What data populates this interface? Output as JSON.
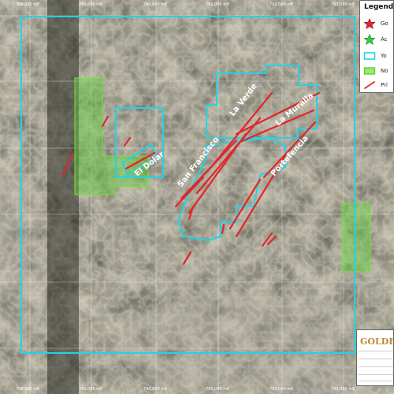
{
  "coords": {
    "top": [
      "788,000 mE",
      "789,000 mE",
      "790,000 mE",
      "791,000 mE",
      "792,000 mE",
      "793,000 mE"
    ],
    "bottom": [
      "788,000 mE",
      "789,000 mE",
      "790,000 mE",
      "791,000 mE",
      "792,000 mE",
      "793,000 mE"
    ]
  },
  "map_labels": {
    "el_dolar": "El Dolar",
    "san_francisco": "San Francisco",
    "la_verde": "La Verde",
    "la_muralla": "La Muralla",
    "portefencia": "Portefencia"
  },
  "legend": {
    "title": "Legend",
    "items": [
      {
        "label": "Go",
        "symbol": "red-star-icon",
        "color": "#e0262b"
      },
      {
        "label": "Ac",
        "symbol": "green-star-icon",
        "color": "#2ecc40"
      },
      {
        "label": "Yo",
        "symbol": "cyan-outline-box-icon",
        "color": "#22d3e6"
      },
      {
        "label": "No",
        "symbol": "green-filled-box-icon",
        "color": "#7ee03a"
      },
      {
        "label": "Pri",
        "symbol": "red-line-icon",
        "color": "#e0262b"
      }
    ]
  },
  "titleblock": {
    "logo": "GOLDEN"
  },
  "colors": {
    "property_outline": "#22d3e6",
    "vein": "#e0262b",
    "neighbor_fill": "#5fd13a"
  }
}
